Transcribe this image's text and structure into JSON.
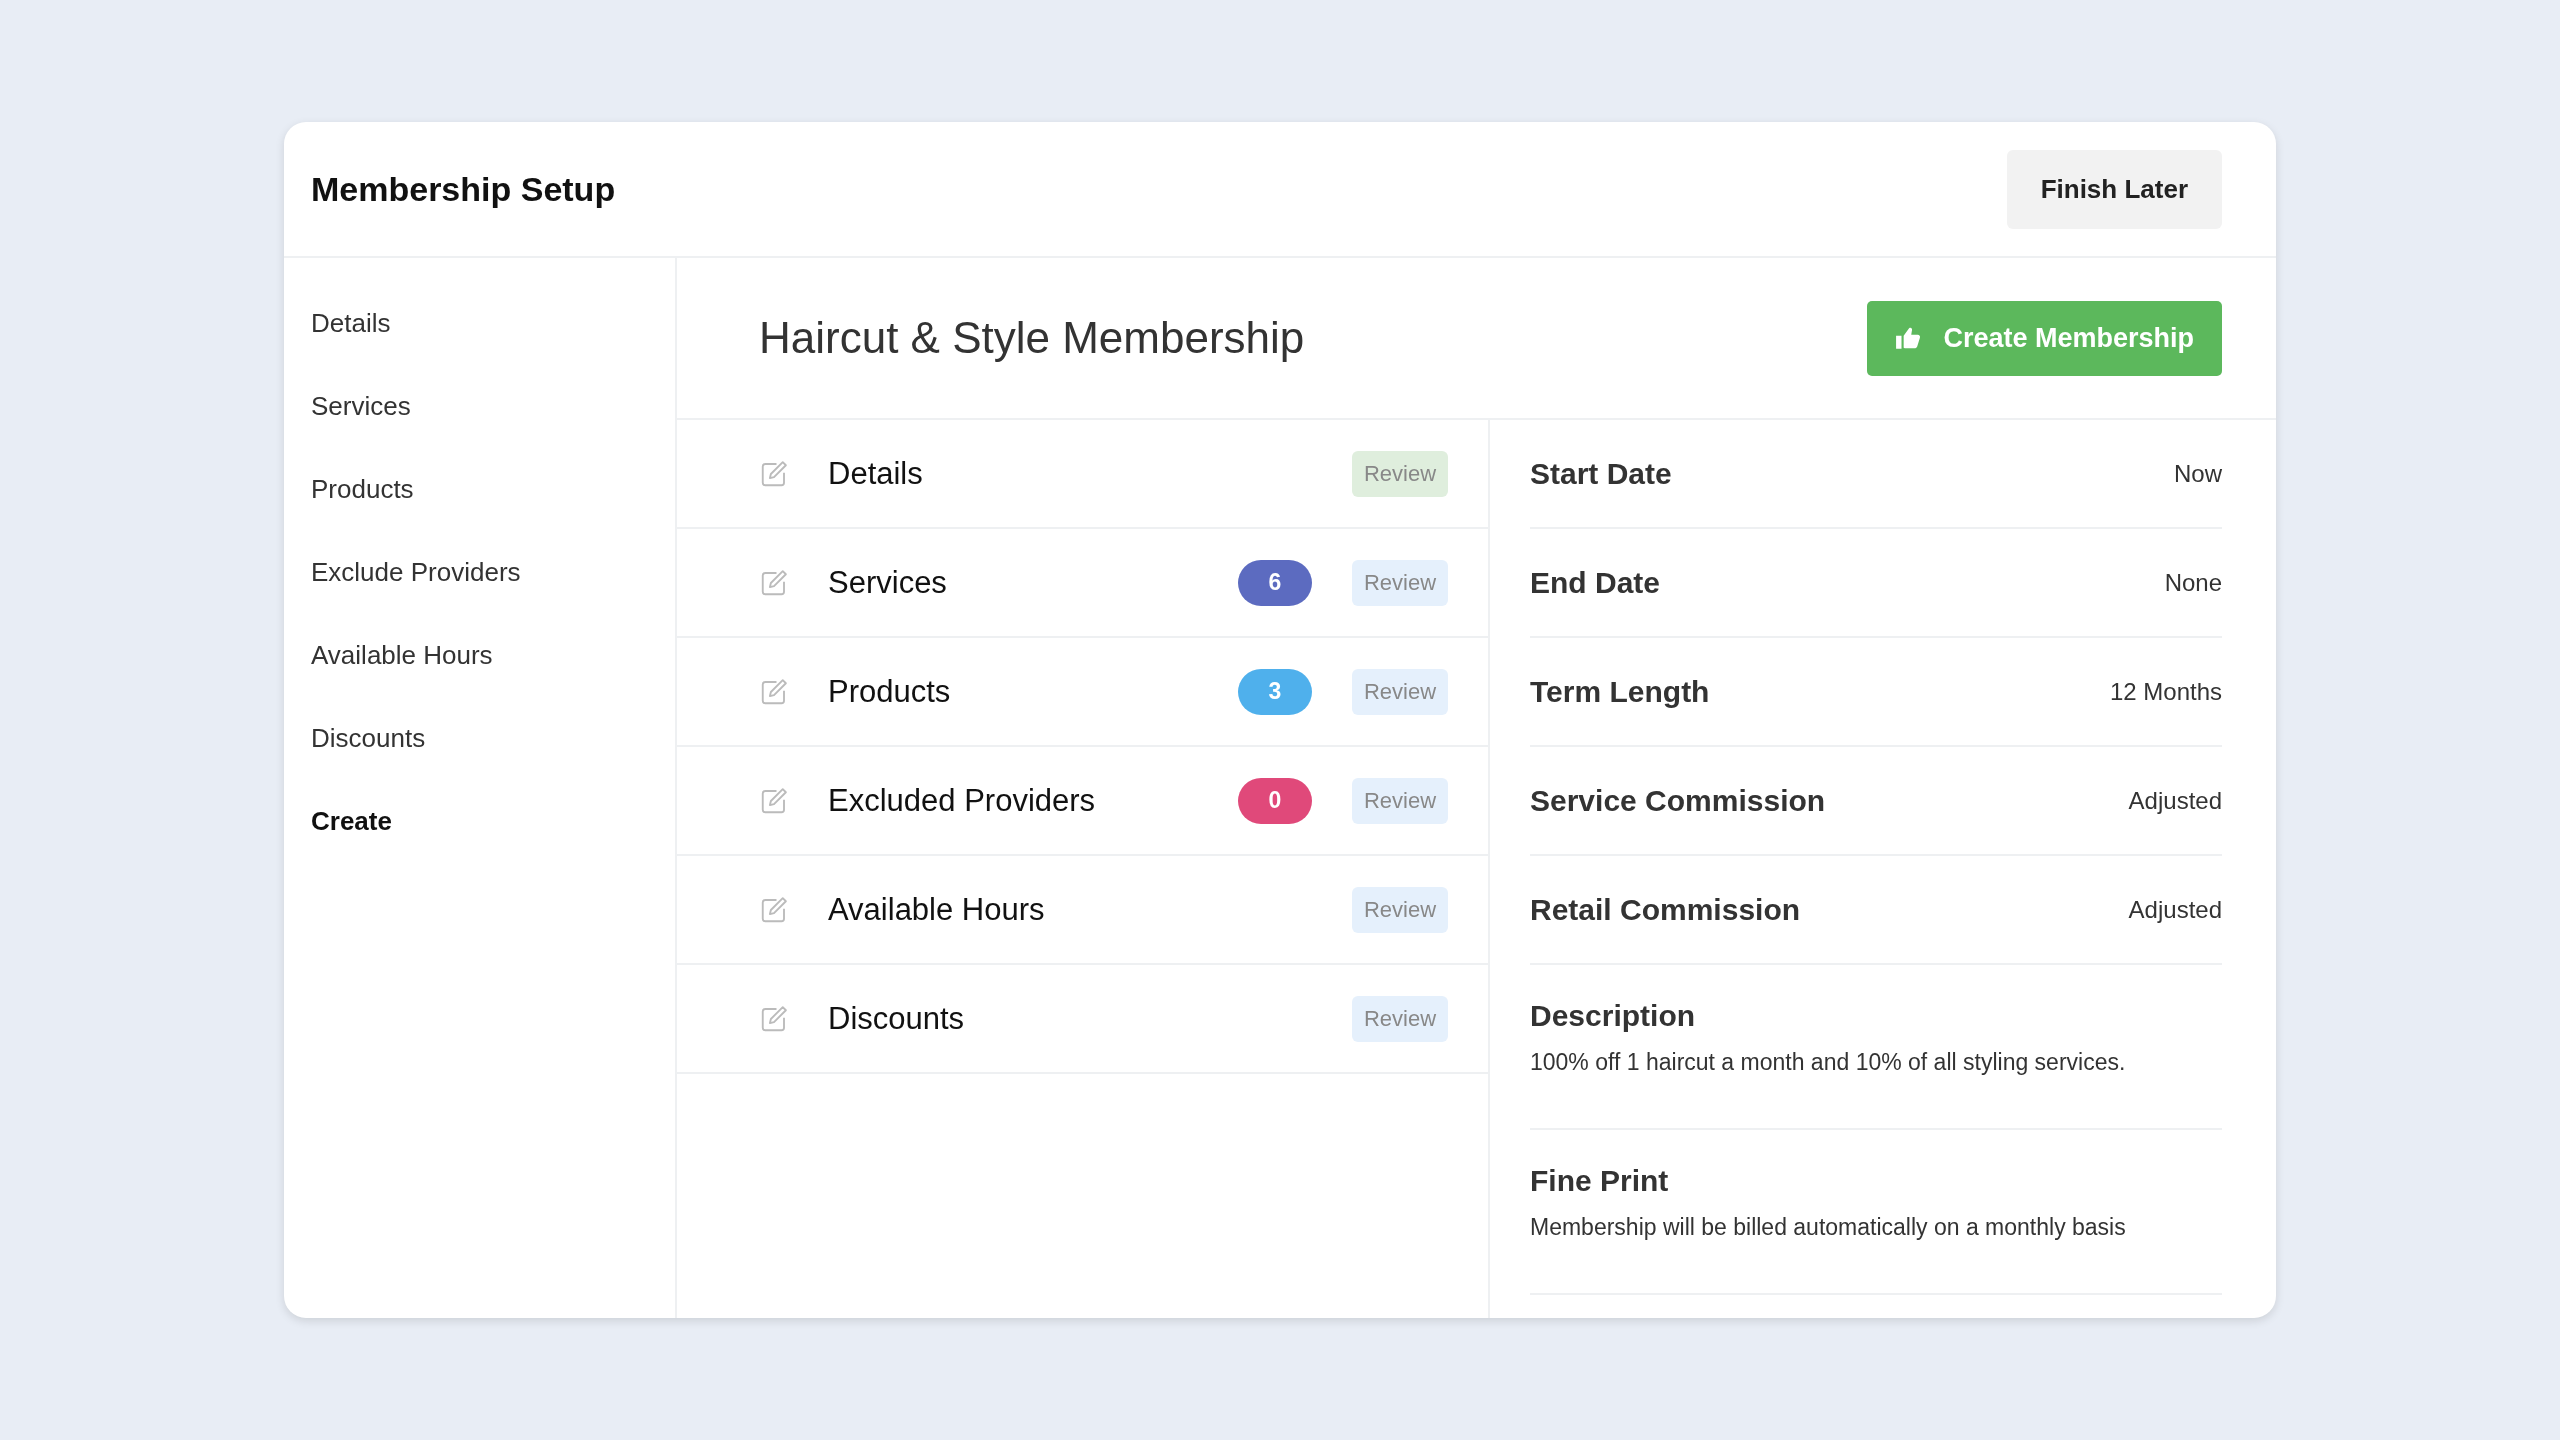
{
  "header": {
    "title": "Membership Setup",
    "finish_button": "Finish Later"
  },
  "sidebar": {
    "items": [
      {
        "label": "Details",
        "selected": false
      },
      {
        "label": "Services",
        "selected": false
      },
      {
        "label": "Products",
        "selected": false
      },
      {
        "label": "Exclude Providers",
        "selected": false
      },
      {
        "label": "Available Hours",
        "selected": false
      },
      {
        "label": "Discounts",
        "selected": false
      },
      {
        "label": "Create",
        "selected": true
      }
    ]
  },
  "main": {
    "title": "Haircut & Style Membership",
    "create_button": "Create Membership"
  },
  "sections": [
    {
      "label": "Details",
      "review": "Review",
      "reviewed": true
    },
    {
      "label": "Services",
      "count": "6",
      "color": "#5c6bc0",
      "review": "Review",
      "reviewed": false
    },
    {
      "label": "Products",
      "count": "3",
      "color": "#4fb0ec",
      "review": "Review",
      "reviewed": false
    },
    {
      "label": "Excluded Providers",
      "count": "0",
      "color": "#e0497a",
      "review": "Review",
      "reviewed": false
    },
    {
      "label": "Available Hours",
      "review": "Review",
      "reviewed": false
    },
    {
      "label": "Discounts",
      "review": "Review",
      "reviewed": false
    }
  ],
  "summary": [
    {
      "kind": "pair",
      "label": "Start Date",
      "value": "Now"
    },
    {
      "kind": "pair",
      "label": "End Date",
      "value": "None"
    },
    {
      "kind": "pair",
      "label": "Term Length",
      "value": "12 Months"
    },
    {
      "kind": "pair",
      "label": "Service Commission",
      "value": "Adjusted"
    },
    {
      "kind": "pair",
      "label": "Retail Commission",
      "value": "Adjusted"
    },
    {
      "kind": "block",
      "label": "Description",
      "value": "100% off 1 haircut a month and 10% of all styling services."
    },
    {
      "kind": "block",
      "label": "Fine Print",
      "value": "Membership will be billed automatically on a monthly basis"
    }
  ]
}
